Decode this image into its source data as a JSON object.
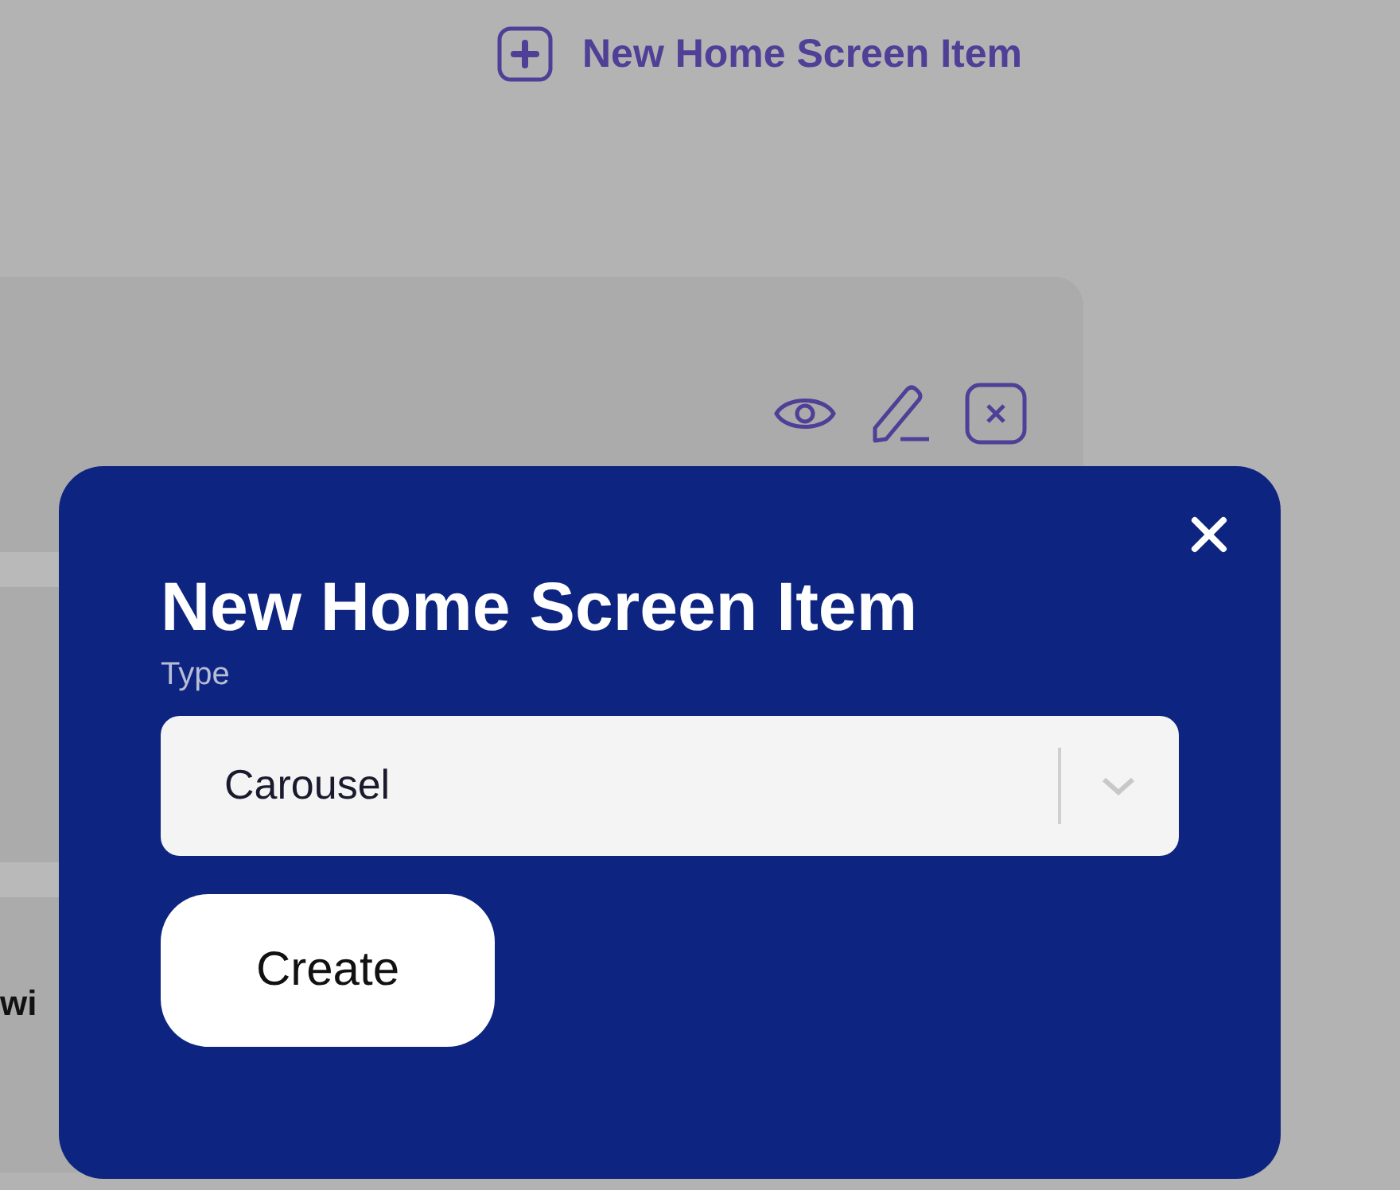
{
  "page": {
    "add_button": {
      "label": "New Home Screen Item"
    },
    "partial_text": "wi"
  },
  "modal": {
    "title": "New Home Screen Item",
    "field": {
      "label": "Type",
      "value": "Carousel"
    },
    "button": "Create"
  }
}
